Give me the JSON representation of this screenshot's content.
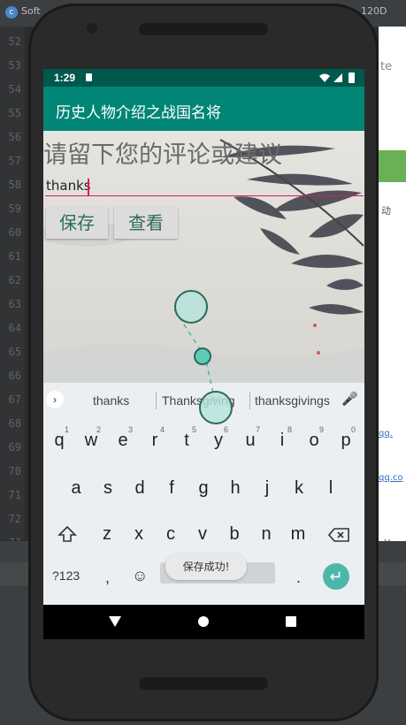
{
  "ide": {
    "tab_label": "Soft",
    "right_tab_label": "120D",
    "right_label_a": "te",
    "right_label_b": "动",
    "right_links": [
      "qq.",
      "qq.co"
    ],
    "line_numbers": [
      "52",
      "53",
      "54",
      "55",
      "56",
      "57",
      "58",
      "59",
      "60",
      "61",
      "62",
      "63",
      "64",
      "65",
      "66",
      "67",
      "68",
      "69",
      "70",
      "71",
      "72",
      "73"
    ]
  },
  "status": {
    "time": "1:29"
  },
  "app": {
    "title": "历史人物介绍之战国名将"
  },
  "form": {
    "prompt": "请留下您的评论或建议",
    "input_value": "thanks",
    "save_label": "保存",
    "view_label": "查看"
  },
  "keyboard": {
    "suggestions": [
      "thanks",
      "Thanksgiving",
      "thanksgivings"
    ],
    "row1": [
      "q",
      "w",
      "e",
      "r",
      "t",
      "y",
      "u",
      "i",
      "o",
      "p"
    ],
    "row1_digits": [
      "1",
      "2",
      "3",
      "4",
      "5",
      "6",
      "7",
      "8",
      "9",
      "0"
    ],
    "row2": [
      "a",
      "s",
      "d",
      "f",
      "g",
      "h",
      "j",
      "k",
      "l"
    ],
    "row3": [
      "z",
      "x",
      "c",
      "v",
      "b",
      "n",
      "m"
    ],
    "symbols_label": "?123",
    "comma": ",",
    "period": "."
  },
  "toast": "保存成功!",
  "colors": {
    "appbar": "#008577",
    "statusbar": "#00574b",
    "accent": "#d81b60"
  },
  "icons": [
    "wifi-icon",
    "signal-icon",
    "battery-icon",
    "mic-icon",
    "shift-icon",
    "backspace-icon",
    "emoji-icon",
    "enter-icon",
    "back-icon",
    "home-icon",
    "recents-icon"
  ]
}
